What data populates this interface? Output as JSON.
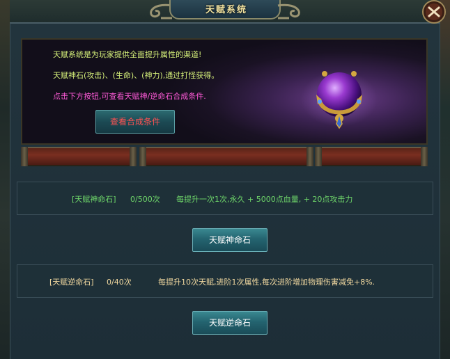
{
  "window": {
    "title": "天赋系统"
  },
  "info": {
    "line1": "天赋系统是为玩家提供全面提升属性的渠道!",
    "line2": "天赋神石(攻击)、(生命)、(神力),通过打怪获得。",
    "line3": "点击下方按钮,可查看天赋神/逆命石合成条件.",
    "view_button_label": "查看合成条件"
  },
  "rows": [
    {
      "name": "[天赋神命石]",
      "count": "0/500次",
      "description": "每提升一次1次,永久 + 5000点血量, + 20点攻击力",
      "button_label": "天赋神命石"
    },
    {
      "name": "[天赋逆命石]",
      "count": "0/40次",
      "description": "每提升10次天赋,进阶1次属性,每次进阶增加物理伤害减免+8%.",
      "button_label": "天赋逆命石"
    }
  ],
  "colors": {
    "info_text": "#d6f07a",
    "info_highlight": "#ff5ad8",
    "view_button_text": "#ff5252",
    "row1_text": "#6fd86a",
    "row2_text": "#f2d9a0",
    "title_text": "#f2e3a0"
  },
  "icons": {
    "close": "close-icon",
    "orb": "talent-orb-icon"
  }
}
